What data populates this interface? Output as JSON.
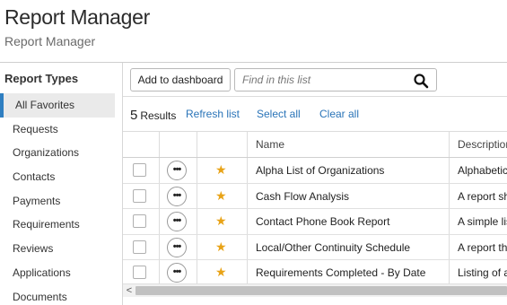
{
  "app": {
    "title": "Report Manager",
    "subtitle": "Report Manager"
  },
  "sidebar": {
    "heading": "Report Types",
    "items": [
      {
        "label": "All Favorites",
        "active": true
      },
      {
        "label": "Requests"
      },
      {
        "label": "Organizations"
      },
      {
        "label": "Contacts"
      },
      {
        "label": "Payments"
      },
      {
        "label": "Requirements"
      },
      {
        "label": "Reviews"
      },
      {
        "label": "Applications"
      },
      {
        "label": "Documents"
      }
    ]
  },
  "toolbar": {
    "add_to_dashboard_label": "Add to dashboard",
    "search_placeholder": "Find in this list",
    "search_icon": "search-icon"
  },
  "results": {
    "count": "5",
    "count_label": "Results",
    "refresh_label": "Refresh list",
    "select_all_label": "Select all",
    "clear_all_label": "Clear all"
  },
  "table": {
    "columns": [
      "Name",
      "Description"
    ],
    "rows": [
      {
        "name": "Alpha List of Organizations",
        "description": "Alphabetic"
      },
      {
        "name": "Cash Flow Analysis",
        "description": "A report sh"
      },
      {
        "name": "Contact Phone Book Report",
        "description": "A simple lis"
      },
      {
        "name": "Local/Other Continuity Schedule",
        "description": "A report th"
      },
      {
        "name": "Requirements Completed - By Date",
        "description": "Listing of a"
      }
    ],
    "more_glyph": "•••",
    "star_glyph": "★"
  },
  "scrollbar": {
    "left_arrow": "<"
  },
  "colors": {
    "accent": "#2f7fc1",
    "link": "#2a74b8",
    "star": "#e8a317"
  }
}
